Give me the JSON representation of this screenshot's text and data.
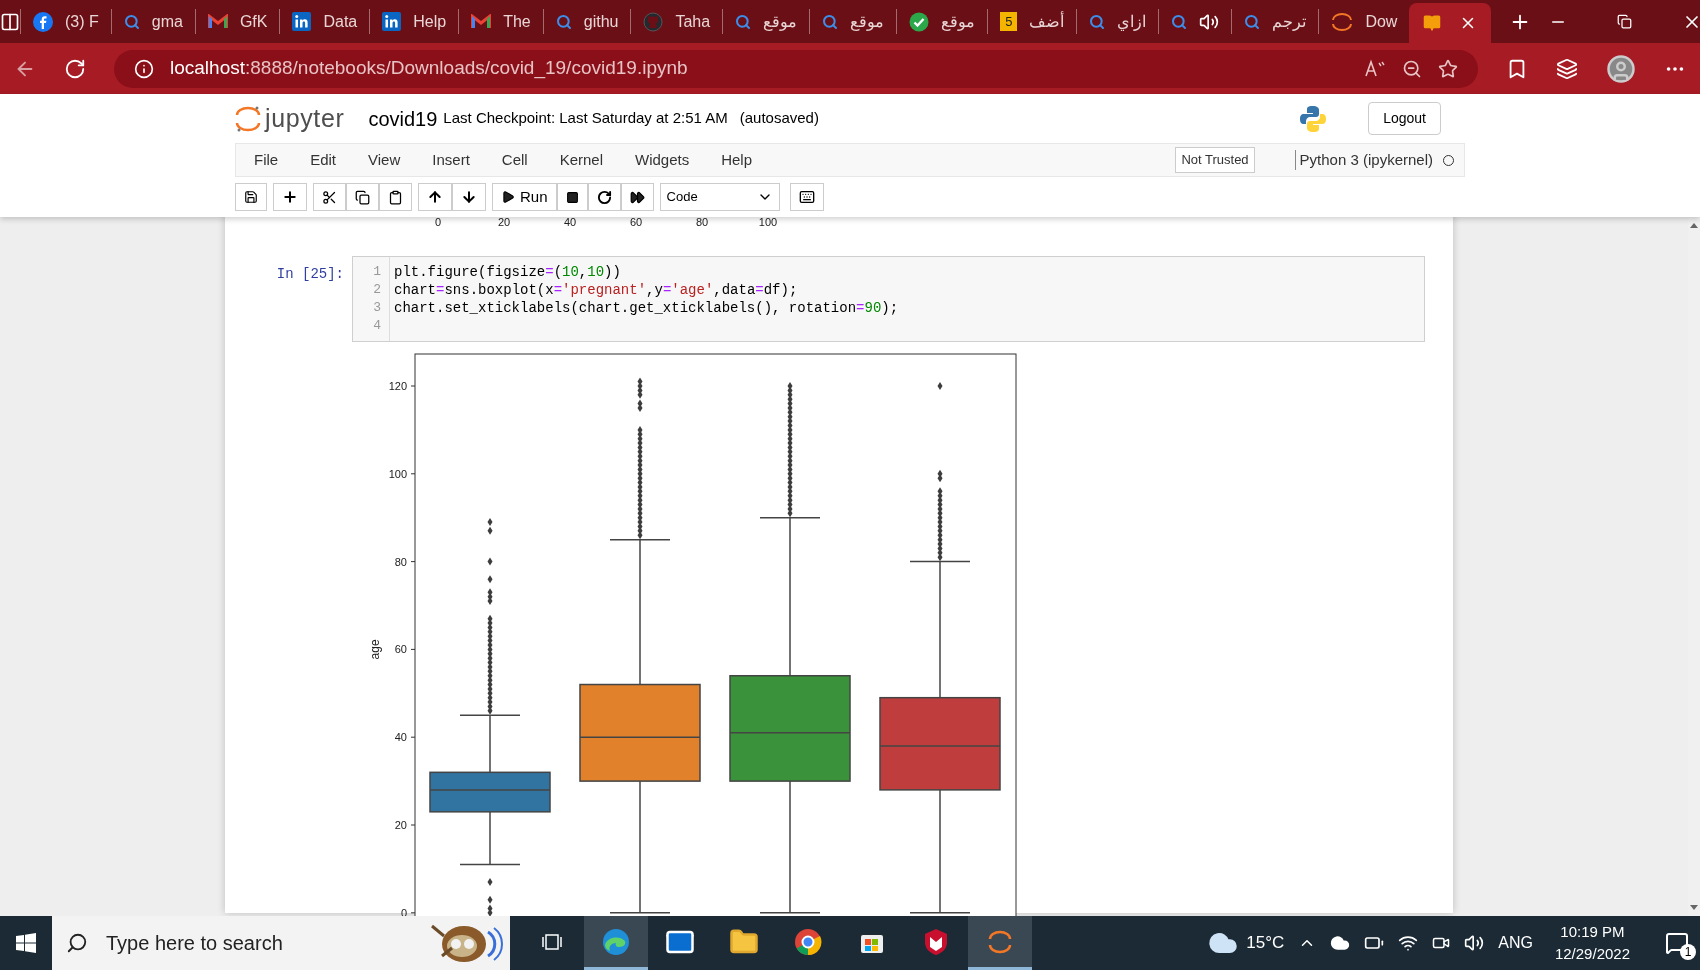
{
  "browser": {
    "tabs": [
      {
        "kind": "social",
        "label": "(3) F",
        "selected": false,
        "audio": false
      },
      {
        "kind": "search",
        "label": "gma",
        "selected": false,
        "audio": false
      },
      {
        "kind": "mail",
        "label": "GfK",
        "selected": false,
        "audio": false
      },
      {
        "kind": "network",
        "label": "Data",
        "selected": false,
        "audio": false
      },
      {
        "kind": "network",
        "label": "Help",
        "selected": false,
        "audio": false
      },
      {
        "kind": "mail",
        "label": "The",
        "selected": false,
        "audio": false
      },
      {
        "kind": "search",
        "label": "githu",
        "selected": false,
        "audio": false
      },
      {
        "kind": "octo",
        "label": "Taha",
        "selected": false,
        "audio": false
      },
      {
        "kind": "search",
        "label": "موقع",
        "selected": false,
        "audio": false
      },
      {
        "kind": "search",
        "label": "موقع",
        "selected": false,
        "audio": false
      },
      {
        "kind": "check",
        "label": "موقع",
        "selected": false,
        "audio": false
      },
      {
        "kind": "badge",
        "badge": "5",
        "label": "أضف",
        "selected": false,
        "audio": false
      },
      {
        "kind": "search",
        "label": "ازاي",
        "selected": false,
        "audio": false
      },
      {
        "kind": "search",
        "selected": false,
        "audio": true
      },
      {
        "kind": "search",
        "label": "ترجم",
        "selected": false,
        "audio": false
      },
      {
        "kind": "arcs",
        "label": "Dow",
        "selected": false,
        "audio": false
      },
      {
        "kind": "book",
        "selected": true,
        "audio": false
      }
    ],
    "address": {
      "host": "localhost",
      "path": ":8888/notebooks/Downloads/covid_19/covid19.ipynb"
    }
  },
  "jupyter": {
    "logo_text": "jupyter",
    "notebook_name": "covid19",
    "checkpoint": "Last Checkpoint: Last Saturday at 2:51 AM",
    "autosave": "(autosaved)",
    "logout": "Logout",
    "menu": [
      "File",
      "Edit",
      "View",
      "Insert",
      "Cell",
      "Kernel",
      "Widgets",
      "Help"
    ],
    "trust": "Not Trusted",
    "kernel": "Python 3 (ipykernel)",
    "kernel_busy": false,
    "run_label": "Run",
    "cell_type": "Code"
  },
  "notebook": {
    "previous_output": {
      "xticks": [
        "0",
        "20",
        "40",
        "60",
        "80",
        "100"
      ]
    },
    "cell": {
      "prompt": "In [25]:",
      "lines": [
        {
          "number": "1",
          "tokens": [
            {
              "kind": "plain",
              "t": "plt.figure(figsize"
            },
            {
              "kind": "op",
              "t": "="
            },
            {
              "kind": "plain",
              "t": "("
            },
            {
              "kind": "num",
              "t": "10"
            },
            {
              "kind": "plain",
              "t": ","
            },
            {
              "kind": "num",
              "t": "10"
            },
            {
              "kind": "plain",
              "t": "))"
            }
          ]
        },
        {
          "number": "2",
          "tokens": [
            {
              "kind": "plain",
              "t": "chart"
            },
            {
              "kind": "op",
              "t": "="
            },
            {
              "kind": "plain",
              "t": "sns.boxplot(x"
            },
            {
              "kind": "op",
              "t": "="
            },
            {
              "kind": "str",
              "t": "'pregnant'"
            },
            {
              "kind": "plain",
              "t": ",y"
            },
            {
              "kind": "op",
              "t": "="
            },
            {
              "kind": "str",
              "t": "'age'"
            },
            {
              "kind": "plain",
              "t": ",data"
            },
            {
              "kind": "op",
              "t": "="
            },
            {
              "kind": "plain",
              "t": "df);"
            }
          ]
        },
        {
          "number": "3",
          "tokens": [
            {
              "kind": "plain",
              "t": "chart.set_xticklabels(chart.get_xticklabels(), rotation"
            },
            {
              "kind": "op",
              "t": "="
            },
            {
              "kind": "num",
              "t": "90"
            },
            {
              "kind": "plain",
              "t": ");"
            }
          ]
        },
        {
          "number": "4"
        }
      ]
    },
    "output": {
      "ylabel": "age",
      "yticks": [
        "120",
        "100",
        "80",
        "60",
        "40",
        "20",
        "0"
      ]
    }
  },
  "taskbar": {
    "search_placeholder": "Type here to search",
    "apps": [
      {
        "kind": "taskview",
        "active": false
      },
      {
        "kind": "browser",
        "active": true
      },
      {
        "kind": "mail",
        "active": false
      },
      {
        "kind": "folder",
        "active": false
      },
      {
        "kind": "chrome",
        "active": false
      },
      {
        "kind": "store",
        "active": false
      },
      {
        "kind": "shield",
        "active": false
      },
      {
        "kind": "arcs",
        "active": true
      }
    ],
    "temperature": "15°C",
    "language": "ANG",
    "time": "10:19 PM",
    "date": "12/29/2022",
    "notifications": "1"
  }
}
